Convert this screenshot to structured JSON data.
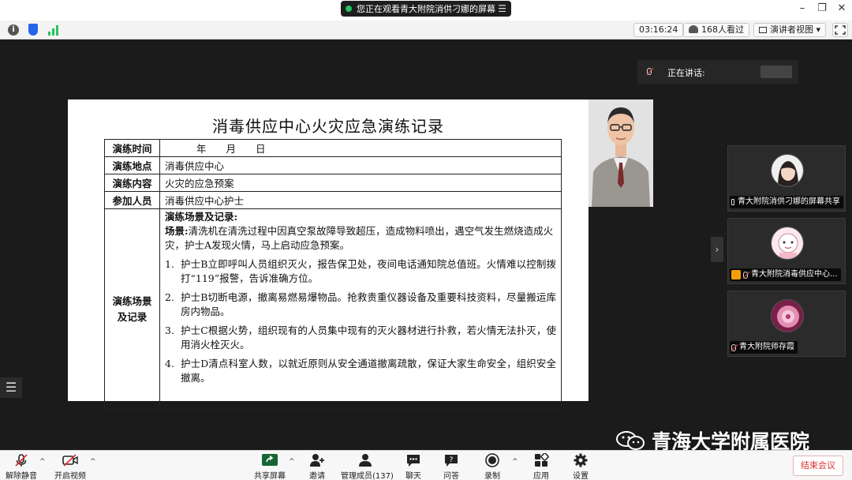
{
  "titlebar": {
    "share_notice": "您正在观看青大附院消供刁娜的屏幕",
    "menu_glyph": "☰",
    "minimize": "–",
    "restore": "❐",
    "close": "✕"
  },
  "infobar": {
    "timer": "03:16:24",
    "viewers": "168人看过",
    "view_mode": "演讲者视图",
    "view_mode_caret": "▾"
  },
  "slide": {
    "title": "消毒供应中心火灾应急演练记录",
    "rows": [
      {
        "label": "演练时间",
        "value": "年　　月　　日"
      },
      {
        "label": "演练地点",
        "value": "消毒供应中心"
      },
      {
        "label": "演练内容",
        "value": "火灾的应急预案"
      },
      {
        "label": "参加人员",
        "value": "消毒供应中心护士"
      }
    ],
    "scene_label_1": "演练场景",
    "scene_label_2": "及记录",
    "scene_heading": "演练场景及记录:",
    "scene_intro_label": "场景:",
    "scene_intro": "清洗机在清洗过程中因真空泵故障导致超压，造成物料喷出，遇空气发生燃烧造成火灾，护士A发现火情，马上启动应急预案。",
    "steps": [
      {
        "num": "1.",
        "text": "护士B立即呼叫人员组织灭火，报告保卫处，夜间电话通知院总值班。火情难以控制拨打“119”报警，告诉准确方位。"
      },
      {
        "num": "2.",
        "text": "护士B切断电源，撤离易燃易爆物品。抢救贵重仪器设备及重要科技资料，尽量搬运库房内物品。"
      },
      {
        "num": "3.",
        "text": "护士C根据火势，组织现有的人员集中现有的灭火器材进行扑救，若火情无法扑灭，使用消火栓灭火。"
      },
      {
        "num": "4.",
        "text": "护士D清点科室人数，以就近原则从安全通道撤离疏散，保证大家生命安全，组织安全撤离。"
      }
    ]
  },
  "speaking": {
    "label": "正在讲话:"
  },
  "participants": [
    {
      "name": "青大附院消供刁娜的屏幕共享"
    },
    {
      "name": "青大附院消毒供应中心..."
    },
    {
      "name": "青大附院师存霞"
    }
  ],
  "controls": {
    "collapse": "›",
    "list": "☰"
  },
  "watermark": {
    "text": "青海大学附属医院"
  },
  "toolbar": {
    "mute": "解除静音",
    "video": "开启视频",
    "share": "共享屏幕",
    "invite": "邀请",
    "members": "管理成员(137)",
    "chat": "聊天",
    "qa": "问答",
    "record": "录制",
    "apps": "应用",
    "settings": "设置",
    "end": "结束会议",
    "caret": "^"
  },
  "colors": {
    "end_red": "#e03131",
    "share_green": "#22c55e",
    "stage": "#1b1b1b",
    "tile": "#2b2b2b"
  }
}
